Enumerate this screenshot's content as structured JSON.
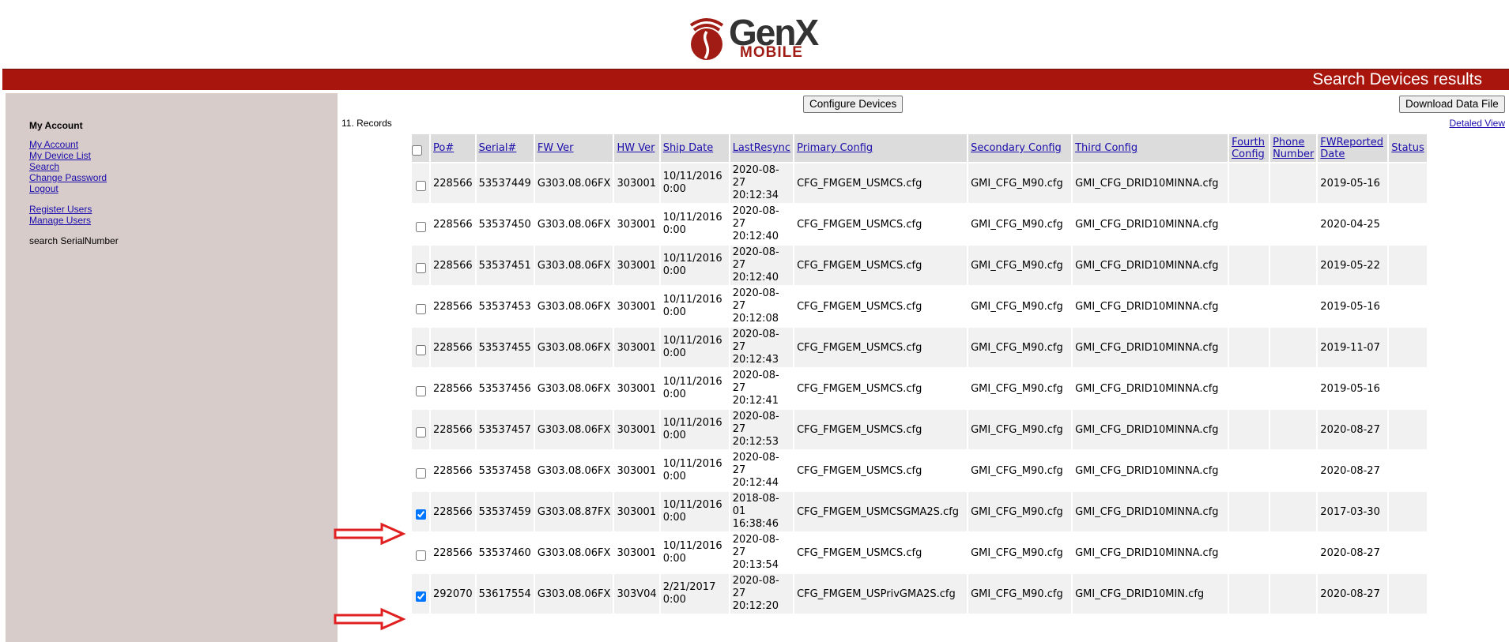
{
  "logo": {
    "name": "GenX",
    "subtitle": "MOBILE"
  },
  "banner": {
    "title": "Search Devices results"
  },
  "sidebar": {
    "heading": "My Account",
    "links": [
      "My Account",
      "My Device List",
      "Search",
      "Change Password",
      "Logout"
    ],
    "admin_links": [
      "Register Users",
      "Manage Users"
    ],
    "search_label": "search SerialNumber"
  },
  "toolbar": {
    "configure_label": "Configure Devices",
    "download_label": "Download Data File",
    "records_label": "11. Records",
    "detailed_view_label": "Detaled View"
  },
  "table": {
    "headers": {
      "po": "Po#",
      "serial": "Serial#",
      "fw_ver": "FW Ver",
      "hw_ver": "HW Ver",
      "ship_date": "Ship Date",
      "last_resync": "LastResync",
      "primary_config": "Primary Config",
      "secondary_config": "Secondary Config",
      "third_config": "Third Config",
      "fourth_config": "Fourth Config",
      "phone_number": "Phone Number",
      "fw_reported_date": "FWReported Date",
      "status": "Status"
    },
    "rows": [
      {
        "checked": false,
        "po": "228566",
        "serial": "53537449",
        "fw": "G303.08.06FX",
        "hw": "303001",
        "ship": "10/11/2016 0:00",
        "resync": "2020-08-27 20:12:34",
        "primary": "CFG_FMGEM_USMCS.cfg",
        "secondary": "GMI_CFG_M90.cfg",
        "third": "GMI_CFG_DRID10MINNA.cfg",
        "fourth": "",
        "phone": "",
        "fwdate": "2019-05-16",
        "status": ""
      },
      {
        "checked": false,
        "po": "228566",
        "serial": "53537450",
        "fw": "G303.08.06FX",
        "hw": "303001",
        "ship": "10/11/2016 0:00",
        "resync": "2020-08-27 20:12:40",
        "primary": "CFG_FMGEM_USMCS.cfg",
        "secondary": "GMI_CFG_M90.cfg",
        "third": "GMI_CFG_DRID10MINNA.cfg",
        "fourth": "",
        "phone": "",
        "fwdate": "2020-04-25",
        "status": ""
      },
      {
        "checked": false,
        "po": "228566",
        "serial": "53537451",
        "fw": "G303.08.06FX",
        "hw": "303001",
        "ship": "10/11/2016 0:00",
        "resync": "2020-08-27 20:12:40",
        "primary": "CFG_FMGEM_USMCS.cfg",
        "secondary": "GMI_CFG_M90.cfg",
        "third": "GMI_CFG_DRID10MINNA.cfg",
        "fourth": "",
        "phone": "",
        "fwdate": "2019-05-22",
        "status": ""
      },
      {
        "checked": false,
        "po": "228566",
        "serial": "53537453",
        "fw": "G303.08.06FX",
        "hw": "303001",
        "ship": "10/11/2016 0:00",
        "resync": "2020-08-27 20:12:08",
        "primary": "CFG_FMGEM_USMCS.cfg",
        "secondary": "GMI_CFG_M90.cfg",
        "third": "GMI_CFG_DRID10MINNA.cfg",
        "fourth": "",
        "phone": "",
        "fwdate": "2019-05-16",
        "status": ""
      },
      {
        "checked": false,
        "po": "228566",
        "serial": "53537455",
        "fw": "G303.08.06FX",
        "hw": "303001",
        "ship": "10/11/2016 0:00",
        "resync": "2020-08-27 20:12:43",
        "primary": "CFG_FMGEM_USMCS.cfg",
        "secondary": "GMI_CFG_M90.cfg",
        "third": "GMI_CFG_DRID10MINNA.cfg",
        "fourth": "",
        "phone": "",
        "fwdate": "2019-11-07",
        "status": ""
      },
      {
        "checked": false,
        "po": "228566",
        "serial": "53537456",
        "fw": "G303.08.06FX",
        "hw": "303001",
        "ship": "10/11/2016 0:00",
        "resync": "2020-08-27 20:12:41",
        "primary": "CFG_FMGEM_USMCS.cfg",
        "secondary": "GMI_CFG_M90.cfg",
        "third": "GMI_CFG_DRID10MINNA.cfg",
        "fourth": "",
        "phone": "",
        "fwdate": "2019-05-16",
        "status": ""
      },
      {
        "checked": false,
        "po": "228566",
        "serial": "53537457",
        "fw": "G303.08.06FX",
        "hw": "303001",
        "ship": "10/11/2016 0:00",
        "resync": "2020-08-27 20:12:53",
        "primary": "CFG_FMGEM_USMCS.cfg",
        "secondary": "GMI_CFG_M90.cfg",
        "third": "GMI_CFG_DRID10MINNA.cfg",
        "fourth": "",
        "phone": "",
        "fwdate": "2020-08-27",
        "status": ""
      },
      {
        "checked": false,
        "po": "228566",
        "serial": "53537458",
        "fw": "G303.08.06FX",
        "hw": "303001",
        "ship": "10/11/2016 0:00",
        "resync": "2020-08-27 20:12:44",
        "primary": "CFG_FMGEM_USMCS.cfg",
        "secondary": "GMI_CFG_M90.cfg",
        "third": "GMI_CFG_DRID10MINNA.cfg",
        "fourth": "",
        "phone": "",
        "fwdate": "2020-08-27",
        "status": ""
      },
      {
        "checked": true,
        "po": "228566",
        "serial": "53537459",
        "fw": "G303.08.87FX",
        "hw": "303001",
        "ship": "10/11/2016 0:00",
        "resync": "2018-08-01 16:38:46",
        "primary": "CFG_FMGEM_USMCSGMA2S.cfg",
        "secondary": "GMI_CFG_M90.cfg",
        "third": "GMI_CFG_DRID10MINNA.cfg",
        "fourth": "",
        "phone": "",
        "fwdate": "2017-03-30",
        "status": ""
      },
      {
        "checked": false,
        "po": "228566",
        "serial": "53537460",
        "fw": "G303.08.06FX",
        "hw": "303001",
        "ship": "10/11/2016 0:00",
        "resync": "2020-08-27 20:13:54",
        "primary": "CFG_FMGEM_USMCS.cfg",
        "secondary": "GMI_CFG_M90.cfg",
        "third": "GMI_CFG_DRID10MINNA.cfg",
        "fourth": "",
        "phone": "",
        "fwdate": "2020-08-27",
        "status": ""
      },
      {
        "checked": true,
        "po": "292070",
        "serial": "53617554",
        "fw": "G303.08.06FX",
        "hw": "303V04",
        "ship": "2/21/2017 0:00",
        "resync": "2020-08-27 20:12:20",
        "primary": "CFG_FMGEM_USPrivGMA2S.cfg",
        "secondary": "GMI_CFG_M90.cfg",
        "third": "GMI_CFG_DRID10MIN.cfg",
        "fourth": "",
        "phone": "",
        "fwdate": "2020-08-27",
        "status": ""
      }
    ]
  },
  "colors": {
    "banner": "#a8150c",
    "sidebar": "#d8ccca",
    "arrow": "#e02020",
    "link": "#1a0dab"
  }
}
